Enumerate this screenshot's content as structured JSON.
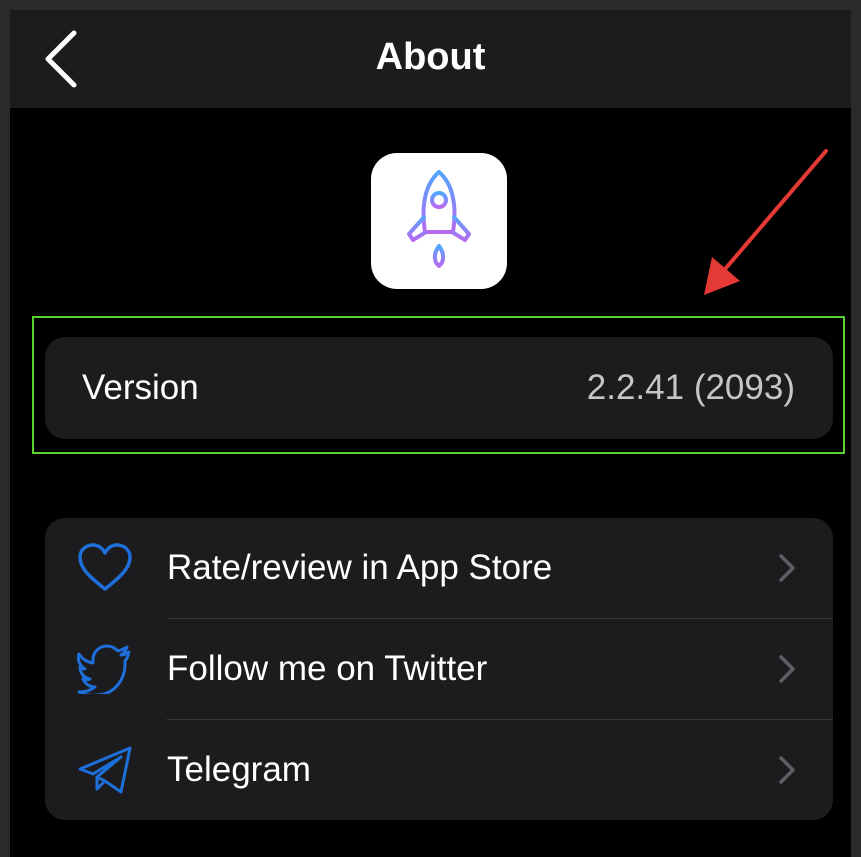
{
  "nav": {
    "title": "About",
    "back_icon": "chevron-left-icon"
  },
  "app": {
    "icon": "rocket-icon"
  },
  "version": {
    "label": "Version",
    "value": "2.2.41 (2093)"
  },
  "links": [
    {
      "label": "Rate/review in App Store",
      "icon": "heart-icon"
    },
    {
      "label": "Follow me on Twitter",
      "icon": "twitter-icon"
    },
    {
      "label": "Telegram",
      "icon": "telegram-icon"
    }
  ],
  "colors": {
    "accent_icon": "#1e6fd9",
    "highlight": "#5ad12c",
    "annotation_arrow": "#e53935",
    "card_bg": "#1c1c1e"
  }
}
